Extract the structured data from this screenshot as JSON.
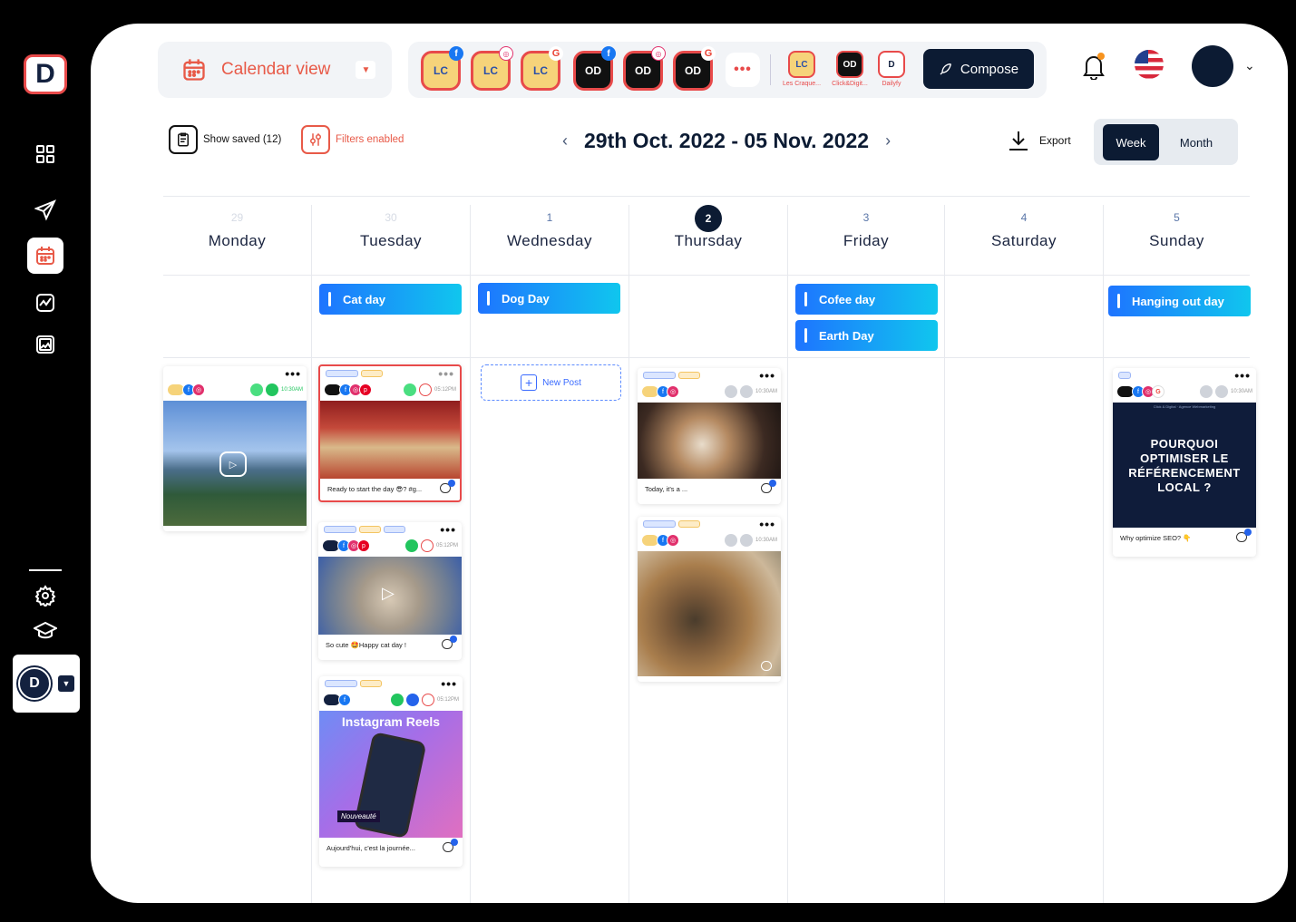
{
  "logo_letter": "D",
  "sidebar": {
    "items": [
      {
        "name": "grid-icon",
        "active": false
      },
      {
        "name": "send-icon",
        "active": false
      },
      {
        "name": "calendar-icon",
        "active": true
      },
      {
        "name": "analytics-icon",
        "active": false
      },
      {
        "name": "gallery-icon",
        "active": false
      },
      {
        "name": "gear-icon",
        "active": false
      },
      {
        "name": "graduation-cap-icon",
        "active": false
      }
    ],
    "account_letter": "D"
  },
  "header": {
    "view_label": "Calendar view",
    "accounts": [
      {
        "name": "Les Craque...",
        "type": "cr",
        "badge": "f"
      },
      {
        "name": "",
        "type": "cr",
        "badge": "ig"
      },
      {
        "name": "",
        "type": "cr",
        "badge": "G"
      },
      {
        "name": "",
        "type": "od",
        "badge": "f"
      },
      {
        "name": "",
        "type": "od",
        "badge": "ig"
      },
      {
        "name": "",
        "type": "od",
        "badge": "G"
      }
    ],
    "mini_accounts": [
      {
        "label": "Les Craque...",
        "type": "cr"
      },
      {
        "label": "Click&Digit...",
        "type": "od"
      },
      {
        "label": "Dailyfy",
        "type": "d"
      }
    ],
    "compose_label": "Compose",
    "accent_color": "#e85a48",
    "dark_color": "#0c1b33"
  },
  "toolbar": {
    "show_saved": "Show saved (12)",
    "filters": "Filters enabled",
    "date_range": "29th Oct. 2022 - 05 Nov. 2022",
    "export": "Export",
    "week": "Week",
    "month": "Month"
  },
  "days": [
    {
      "num": "29",
      "name": "Monday",
      "dim": true
    },
    {
      "num": "30",
      "name": "Tuesday",
      "dim": true
    },
    {
      "num": "1",
      "name": "Wednesday",
      "dim": false
    },
    {
      "num": "2",
      "name": "Thursday",
      "today": true
    },
    {
      "num": "3",
      "name": "Friday",
      "dim": false
    },
    {
      "num": "4",
      "name": "Saturday",
      "dim": false
    },
    {
      "num": "5",
      "name": "Sunday",
      "dim": false
    }
  ],
  "events": {
    "tue": "Cat day",
    "wed": "Dog Day",
    "fri1": "Cofee day",
    "fri2": "Earth Day",
    "sun": "Hanging out day"
  },
  "posts": {
    "mon_time": "10:30AM",
    "tue1_caption": "Ready to start the day 😎? #g...",
    "tue1_time": "05:12PM",
    "tue2_caption": "So cute 🤩Happy cat day !",
    "tue2_time": "05:12PM",
    "tue3_caption": "Aujourd'hui, c'est la journée...",
    "tue3_time": "05:12PM",
    "tue3_img_title": "Instagram Reels",
    "tue3_img_badge": "Nouveauté",
    "thu1_caption": "Today, it's a ...",
    "thu1_time": "10:30AM",
    "thu2_time": "10:30AM",
    "sun_caption": "Why optimize SEO? 👇",
    "sun_time": "10:30AM",
    "sun_img_text": "POURQUOI OPTIMISER LE RÉFÉRENCEMENT LOCAL ?",
    "sun_img_header": "Click & Digital · Agence Webmarketing"
  },
  "new_post_label": "New Post"
}
